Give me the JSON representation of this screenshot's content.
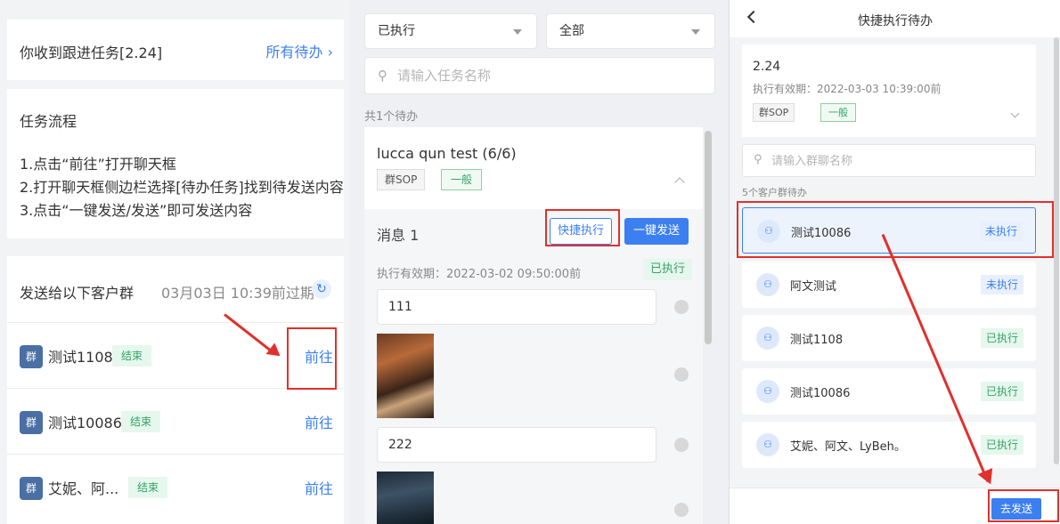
{
  "left": {
    "header": {
      "title": "你收到跟进任务[2.24]",
      "link": "所有待办"
    },
    "flow": {
      "title": "任务流程",
      "steps": [
        "1.点击“前往”打开聊天框",
        "2.打开聊天框侧边栏选择[待办任务]找到待发送内容",
        "3.点击“一键发送/发送”即可发送内容"
      ]
    },
    "groups": {
      "title": "发送给以下客户群",
      "expire": "03月03日 10:39前过期",
      "rows": [
        {
          "name": "测试1108",
          "status": "结束",
          "action": "前往"
        },
        {
          "name": "测试10086",
          "status": "结束",
          "action": "前往"
        },
        {
          "name": "艾妮、阿...",
          "status": "结束",
          "action": "前往"
        }
      ]
    }
  },
  "middle": {
    "filter_status": "已执行",
    "filter_scope": "全部",
    "search_placeholder": "请输入任务名称",
    "count": "共1个待办",
    "task": {
      "name": "lucca qun test  (6/6)",
      "tag_type": "群SOP",
      "tag_level": "一般",
      "message": {
        "title": "消息 1",
        "quick_button": "快捷执行",
        "send_button": "一键发送",
        "valid_until": "执行有效期：2022-03-02 09:50:00前",
        "status": "已执行",
        "items": [
          "111",
          "222"
        ]
      }
    }
  },
  "right": {
    "title": "快捷执行待办",
    "info": {
      "name": "2.24",
      "valid_until": "执行有效期：2022-03-03 10:39:00前",
      "tag_type": "群SOP",
      "tag_level": "一般"
    },
    "search_placeholder": "请输入群聊名称",
    "count": "5个客户群待办",
    "groups": [
      {
        "name": "测试10086",
        "status": "未执行"
      },
      {
        "name": "阿文测试",
        "status": "未执行"
      },
      {
        "name": "测试1108",
        "status": "已执行"
      },
      {
        "name": "测试10086",
        "status": "已执行"
      },
      {
        "name": "艾妮、阿文、LyBeh。",
        "status": "已执行"
      }
    ],
    "go_button": "去发送"
  }
}
